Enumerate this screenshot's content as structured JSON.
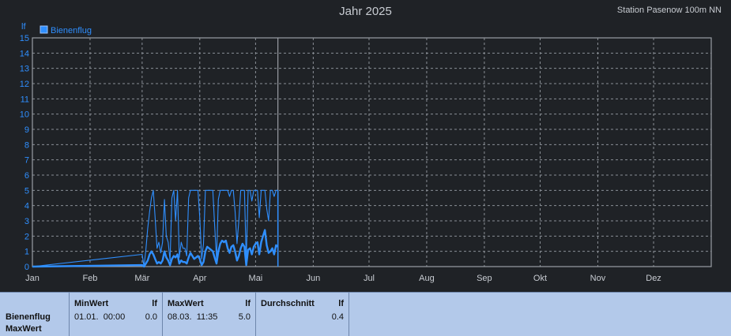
{
  "header": {
    "title": "Jahr 2025",
    "station": "Station Pasenow 100m NN"
  },
  "chart_data": {
    "type": "line",
    "title": "Jahr 2025",
    "ylabel": "lf",
    "ylim": [
      0,
      15
    ],
    "yticks": [
      0,
      1,
      2,
      3,
      4,
      5,
      6,
      7,
      8,
      9,
      10,
      11,
      12,
      13,
      14,
      15
    ],
    "x_tick_labels": [
      "Jan",
      "Feb",
      "Mär",
      "Apr",
      "Mai",
      "Jun",
      "Jul",
      "Aug",
      "Sep",
      "Okt",
      "Nov",
      "Dez"
    ],
    "grid": true,
    "legend": "top-left",
    "series": [
      {
        "name": "Bienenflug",
        "color": "#2f8fff",
        "day_of_year": [
          1,
          60,
          61,
          62,
          63,
          64,
          65,
          66,
          67,
          68,
          69,
          70,
          71,
          72,
          73,
          74,
          75,
          76,
          77,
          78,
          79,
          80,
          81,
          82,
          83,
          84,
          85,
          86,
          87,
          88,
          89,
          90,
          91,
          92,
          93,
          94,
          95,
          96,
          97,
          98,
          99,
          100,
          101,
          102,
          103,
          104,
          105,
          106,
          107,
          108,
          109,
          110,
          111,
          112,
          113,
          114,
          115,
          116,
          117,
          118,
          119,
          120,
          121,
          122,
          123,
          124,
          125,
          126,
          127,
          128,
          129,
          130,
          131,
          132,
          133
        ],
        "max": [
          0,
          0.8,
          0,
          1.1,
          2.5,
          3.6,
          4.5,
          5,
          3.2,
          1.2,
          1.6,
          0.9,
          1.6,
          4.4,
          2,
          1.6,
          0.4,
          4.5,
          5,
          3,
          5,
          0.6,
          1.6,
          1.2,
          1.2,
          0.7,
          4.5,
          5,
          5,
          5,
          5,
          5,
          3.2,
          0.5,
          1.5,
          5,
          5,
          5,
          5,
          5,
          2.7,
          0.5,
          4.4,
          5,
          5,
          5,
          5,
          5,
          4.6,
          5,
          5,
          3.6,
          1.5,
          3,
          5,
          5,
          5,
          0.4,
          5,
          5,
          4.3,
          5,
          5,
          5,
          3.2,
          5,
          5,
          5,
          3.8,
          3,
          5,
          5,
          4.6,
          5,
          5
        ],
        "mean": [
          0,
          0.1,
          0,
          0.2,
          0.4,
          0.8,
          1,
          0.8,
          0.5,
          0.2,
          0.3,
          0.2,
          0.4,
          1,
          0.6,
          0.4,
          0.1,
          0.5,
          0.7,
          0.6,
          0.8,
          0.2,
          0.4,
          0.3,
          0.3,
          0.2,
          0.6,
          0.9,
          0.7,
          0.5,
          0.6,
          0.7,
          0.5,
          0.1,
          0.3,
          1,
          1.3,
          1.2,
          1.1,
          1,
          0.6,
          0.2,
          1,
          1.5,
          1.7,
          1.6,
          1.7,
          1.2,
          0.9,
          1.3,
          1.4,
          1,
          0.4,
          0.7,
          1.2,
          1.5,
          1.3,
          0.1,
          1.1,
          1.2,
          0.8,
          1.3,
          1.5,
          1.6,
          0.8,
          1.6,
          2,
          2.4,
          1.4,
          0.9,
          1,
          1.2,
          0.8,
          1.4,
          1.3
        ]
      }
    ]
  },
  "stats": {
    "row_label_1": "Bienenflug",
    "row_label_2": "MaxWert",
    "columns": [
      {
        "header": "MinWert",
        "unit": "lf",
        "date": "01.01.  00:00",
        "value": "0.0"
      },
      {
        "header": "MaxWert",
        "unit": "lf",
        "date": "08.03.  11:35",
        "value": "5.0"
      },
      {
        "header": "Durchschnitt",
        "unit": "lf",
        "date": "",
        "value": "0.4"
      }
    ]
  }
}
